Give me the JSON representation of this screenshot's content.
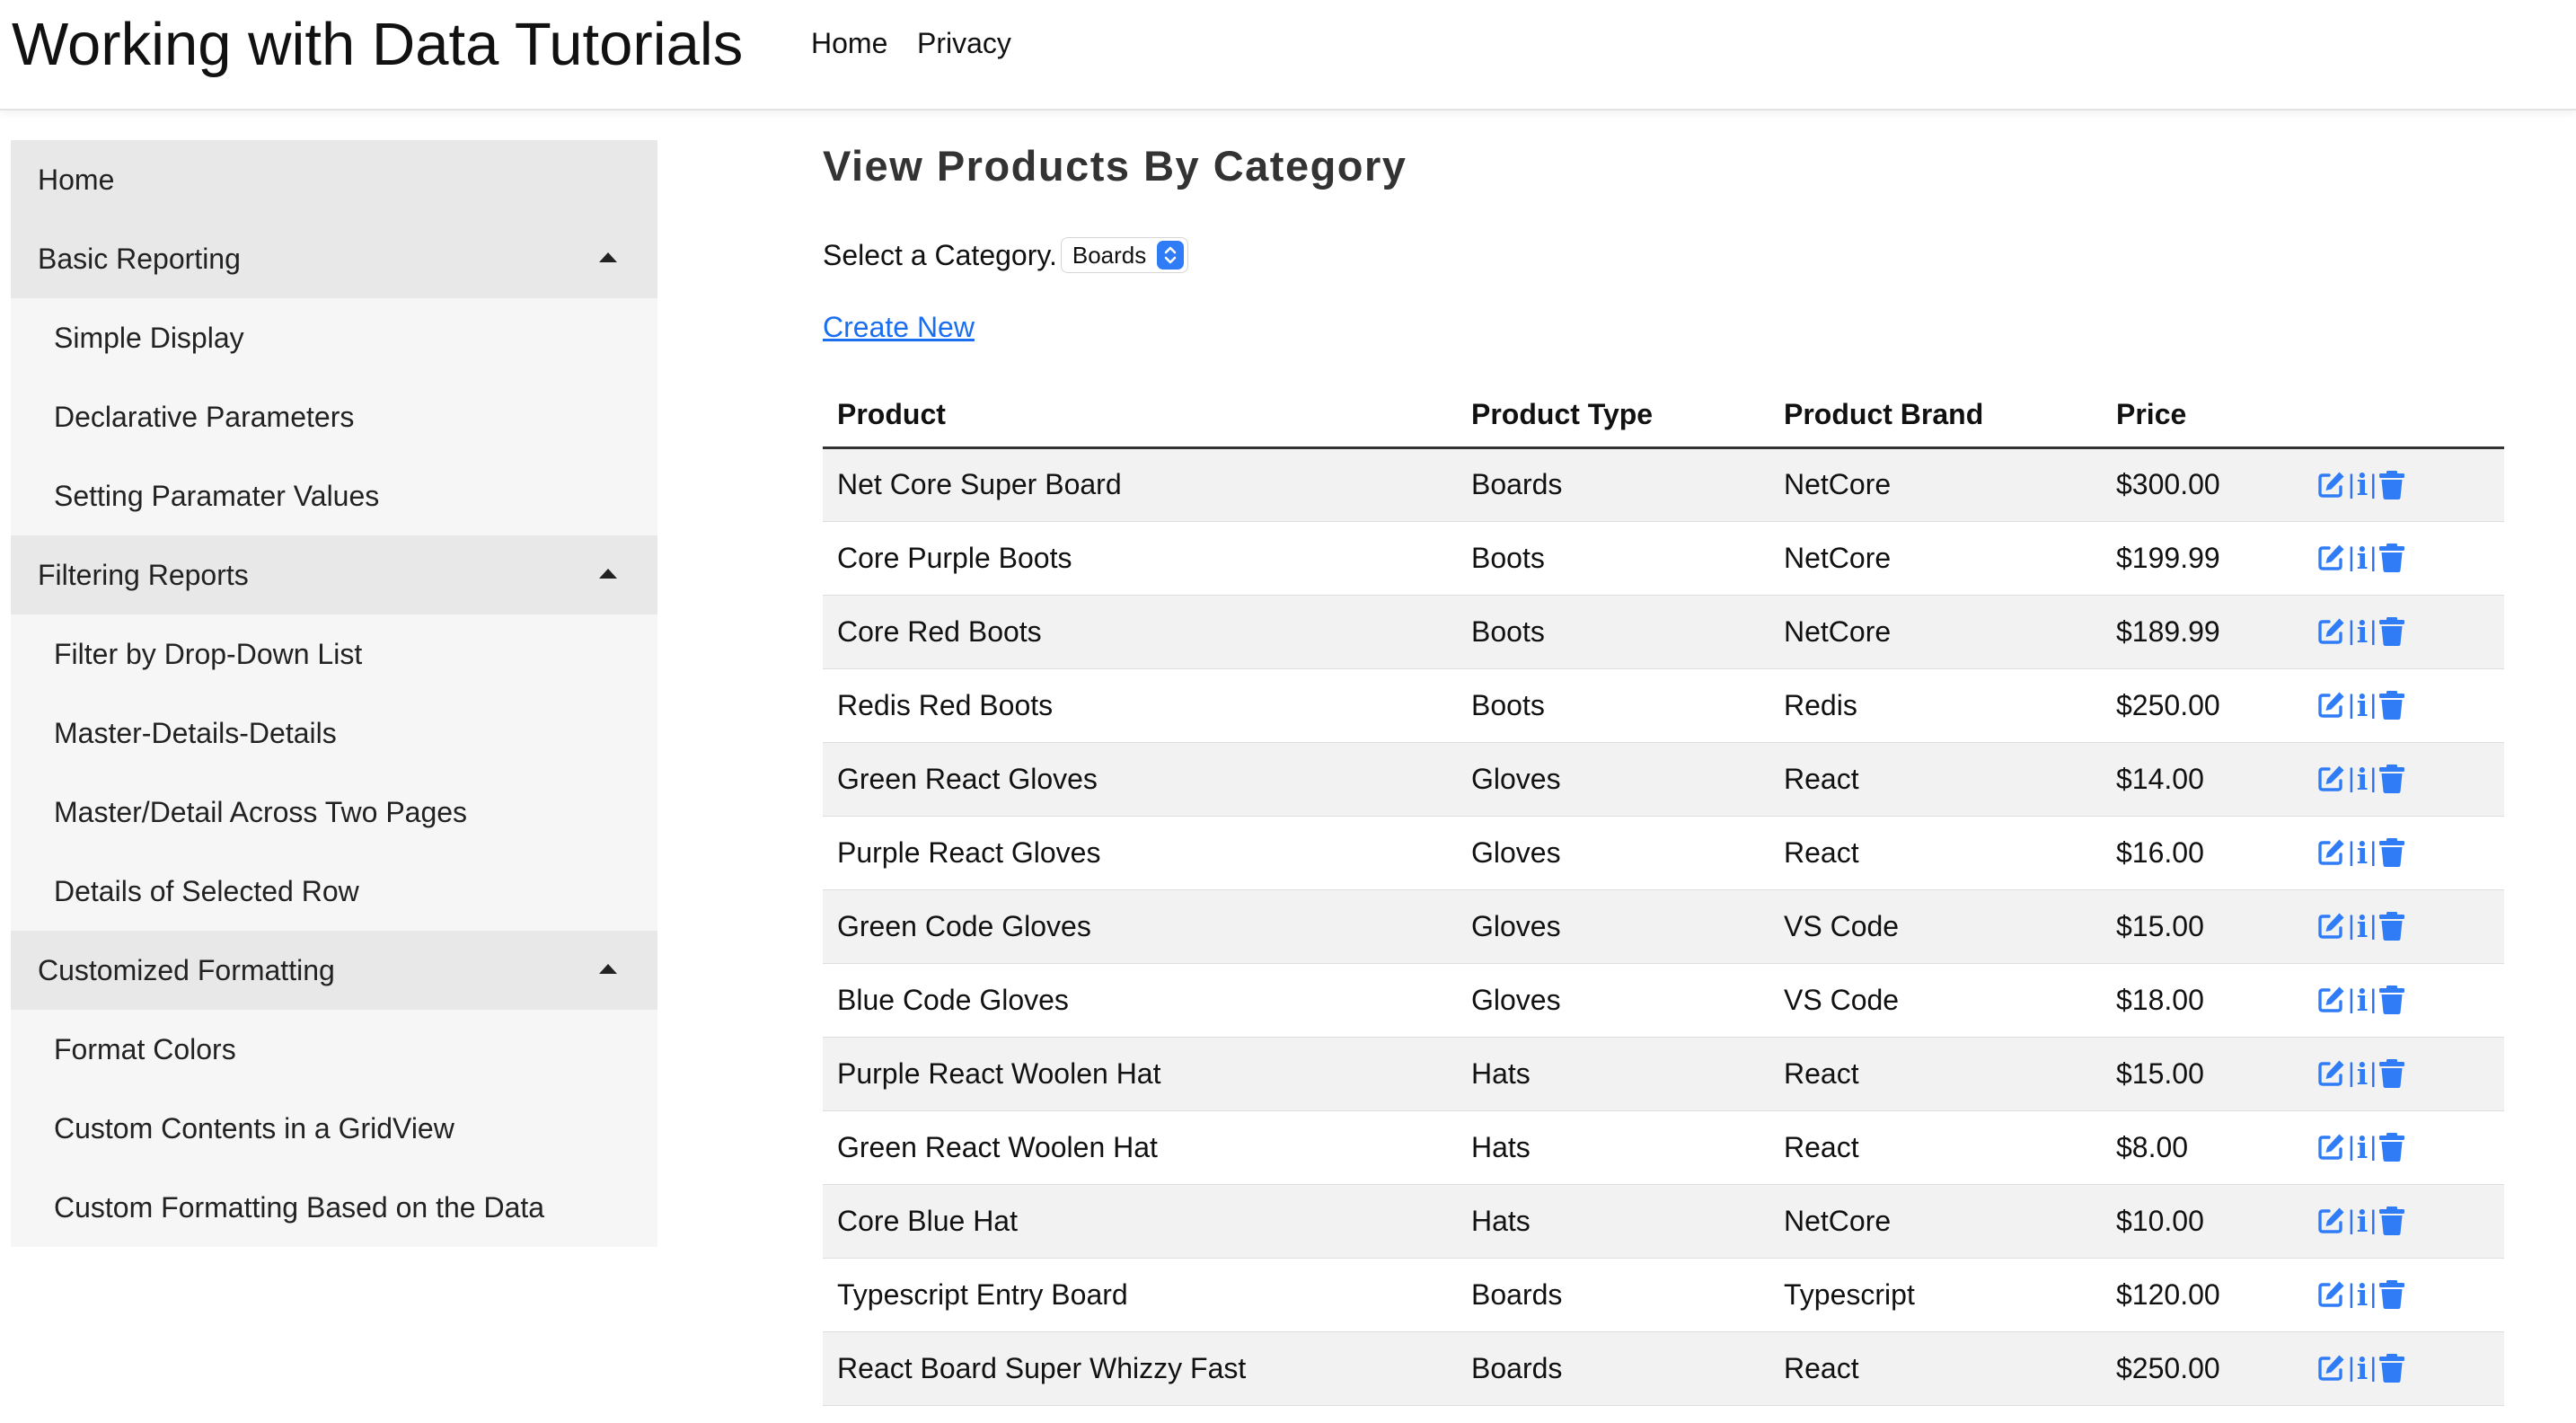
{
  "header": {
    "brand": "Working with Data Tutorials",
    "nav": [
      {
        "label": "Home"
      },
      {
        "label": "Privacy"
      }
    ]
  },
  "sidebar": {
    "items": [
      {
        "label": "Home",
        "level": "top"
      },
      {
        "label": "Basic Reporting",
        "level": "top",
        "expanded": true
      },
      {
        "label": "Simple Display",
        "level": "sub"
      },
      {
        "label": "Declarative Parameters",
        "level": "sub"
      },
      {
        "label": "Setting Paramater Values",
        "level": "sub"
      },
      {
        "label": "Filtering Reports",
        "level": "top",
        "expanded": true
      },
      {
        "label": "Filter by Drop-Down List",
        "level": "sub"
      },
      {
        "label": "Master-Details-Details",
        "level": "sub"
      },
      {
        "label": "Master/Detail Across Two Pages",
        "level": "sub"
      },
      {
        "label": "Details of Selected Row",
        "level": "sub"
      },
      {
        "label": "Customized Formatting",
        "level": "top",
        "expanded": true
      },
      {
        "label": "Format Colors",
        "level": "sub"
      },
      {
        "label": "Custom Contents in a GridView",
        "level": "sub"
      },
      {
        "label": "Custom Formatting Based on the Data",
        "level": "sub"
      }
    ]
  },
  "main": {
    "title": "View Products By Category",
    "select_label": "Select a Category.",
    "selected_category": "Boards",
    "create_link": "Create New",
    "action_separator": "|",
    "table": {
      "columns": [
        "Product",
        "Product Type",
        "Product Brand",
        "Price"
      ],
      "rows": [
        {
          "product": "Net Core Super Board",
          "type": "Boards",
          "brand": "NetCore",
          "price": "$300.00"
        },
        {
          "product": "Core Purple Boots",
          "type": "Boots",
          "brand": "NetCore",
          "price": "$199.99"
        },
        {
          "product": "Core Red Boots",
          "type": "Boots",
          "brand": "NetCore",
          "price": "$189.99"
        },
        {
          "product": "Redis Red Boots",
          "type": "Boots",
          "brand": "Redis",
          "price": "$250.00"
        },
        {
          "product": "Green React Gloves",
          "type": "Gloves",
          "brand": "React",
          "price": "$14.00"
        },
        {
          "product": "Purple React Gloves",
          "type": "Gloves",
          "brand": "React",
          "price": "$16.00"
        },
        {
          "product": "Green Code Gloves",
          "type": "Gloves",
          "brand": "VS Code",
          "price": "$15.00"
        },
        {
          "product": "Blue Code Gloves",
          "type": "Gloves",
          "brand": "VS Code",
          "price": "$18.00"
        },
        {
          "product": "Purple React Woolen Hat",
          "type": "Hats",
          "brand": "React",
          "price": "$15.00"
        },
        {
          "product": "Green React Woolen Hat",
          "type": "Hats",
          "brand": "React",
          "price": "$8.00"
        },
        {
          "product": "Core Blue Hat",
          "type": "Hats",
          "brand": "NetCore",
          "price": "$10.00"
        },
        {
          "product": "Typescript Entry Board",
          "type": "Boards",
          "brand": "Typescript",
          "price": "$120.00"
        },
        {
          "product": "React Board Super Whizzy Fast",
          "type": "Boards",
          "brand": "React",
          "price": "$250.00"
        }
      ],
      "row_actions": [
        "edit-icon",
        "info-icon",
        "trash-icon"
      ]
    }
  },
  "colors": {
    "accent": "#2f7cf6",
    "link": "#1a6ff0",
    "sidebar_section_bg": "#e8e8e8",
    "sidebar_item_bg": "#f6f6f6",
    "table_stripe": "#f2f2f2"
  }
}
